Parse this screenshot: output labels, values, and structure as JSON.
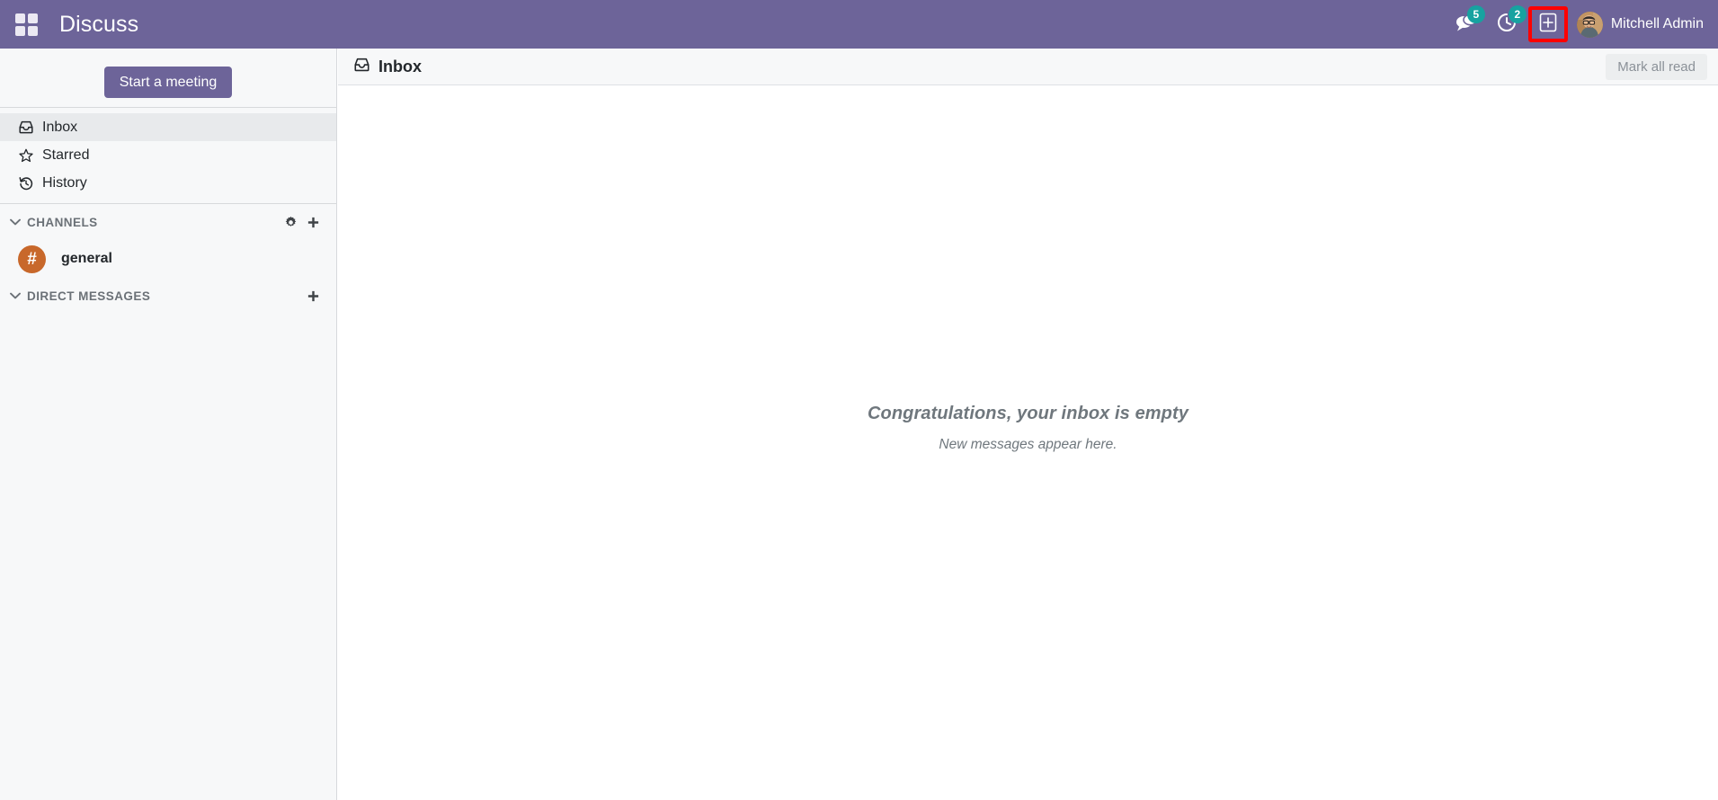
{
  "navbar": {
    "apps_icon": "apps-grid-icon",
    "app_title": "Discuss",
    "messages": {
      "icon": "speech-bubbles-icon",
      "count": "5"
    },
    "activities": {
      "icon": "clock-icon",
      "count": "2"
    },
    "new_message": {
      "icon": "plus-square-icon",
      "highlighted": true,
      "highlight_color": "#ff0000"
    },
    "user": {
      "avatar": "user-avatar",
      "name": "Mitchell Admin"
    },
    "background_color": "#6d6499"
  },
  "sidebar": {
    "start_meeting_label": "Start a meeting",
    "mailboxes": [
      {
        "label": "Inbox",
        "icon": "inbox-icon",
        "active": true
      },
      {
        "label": "Starred",
        "icon": "star-icon",
        "active": false
      },
      {
        "label": "History",
        "icon": "history-icon",
        "active": false
      }
    ],
    "channels_section": {
      "title": "CHANNELS",
      "caret": "chevron-down-icon",
      "settings_icon": "gear-icon",
      "add_icon": "plus-icon",
      "items": [
        {
          "name": "general",
          "symbol": "#",
          "avatar_color": "#c8682b"
        }
      ]
    },
    "direct_messages_section": {
      "title": "DIRECT MESSAGES",
      "caret": "chevron-down-icon",
      "add_icon": "plus-icon",
      "items": []
    },
    "background_color": "#f7f8f9",
    "active_item_color": "#e8eaec"
  },
  "main": {
    "thread": {
      "icon": "inbox-icon",
      "title": "Inbox",
      "mark_all_read_label": "Mark all read"
    },
    "empty_state": {
      "title": "Congratulations, your inbox is empty",
      "subtitle": "New messages appear here."
    }
  }
}
